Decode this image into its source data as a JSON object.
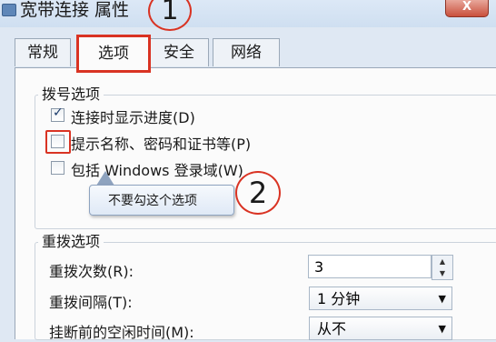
{
  "window": {
    "title": "宽带连接 属性",
    "close_label": "X"
  },
  "annotations": {
    "step1": "1",
    "step2": "2"
  },
  "tabs": [
    {
      "label": "常规"
    },
    {
      "label": "选项",
      "active": true
    },
    {
      "label": "安全"
    },
    {
      "label": "网络"
    }
  ],
  "dial_options": {
    "legend": "拨号选项",
    "items": [
      {
        "label": "连接时显示进度(D)",
        "checked": true
      },
      {
        "label": "提示名称、密码和证书等(P)",
        "checked": false
      },
      {
        "label": "包括 Windows 登录域(W)",
        "checked": false
      }
    ]
  },
  "tooltip": {
    "text": "不要勾这个选项"
  },
  "redial_options": {
    "legend": "重拨选项",
    "attempts_label": "重拨次数(R):",
    "attempts_value": "3",
    "interval_label": "重拨间隔(T):",
    "interval_value": "1 分钟",
    "idle_label": "挂断前的空闲时间(M):",
    "idle_value": "从不"
  },
  "colors": {
    "annotation": "#d93323",
    "panel": "#fbfbfb",
    "titlebar": "#cfdff1"
  }
}
